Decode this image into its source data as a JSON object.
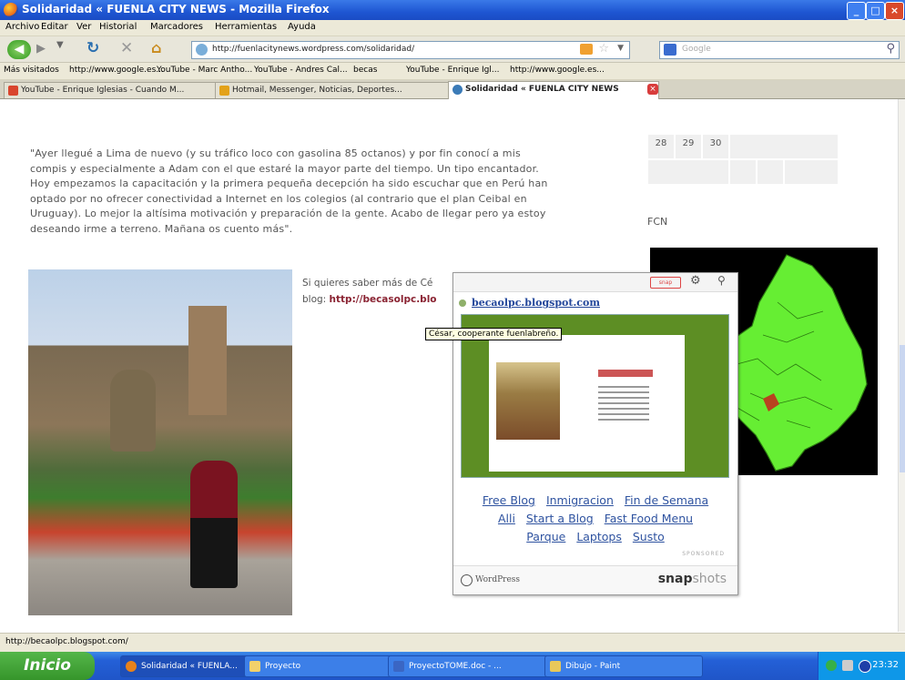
{
  "window": {
    "title": "Solidaridad « FUENLA CITY NEWS - Mozilla Firefox",
    "controls": {
      "minimize": "_",
      "maximize": "□",
      "close": "×"
    }
  },
  "menu": [
    "Archivo",
    "Editar",
    "Ver",
    "Historial",
    "Marcadores",
    "Herramientas",
    "Ayuda"
  ],
  "nav": {
    "url": "http://fuenlacitynews.wordpress.com/solidaridad/",
    "search_placeholder": "Google"
  },
  "bookmarks": [
    "Más visitados",
    "http://www.google.es...",
    "YouTube - Marc Antho...",
    "YouTube - Andres Cal...",
    "becas",
    "YouTube - Enrique Igl...",
    "http://www.google.es..."
  ],
  "tabs": [
    {
      "label": "YouTube - Enrique Iglesias - Cuando M...",
      "active": false,
      "color": "#d9452e"
    },
    {
      "label": "Hotmail, Messenger, Noticias, Deportes...",
      "active": false,
      "color": "#e3a21a"
    },
    {
      "label": "Solidaridad « FUENLA CITY NEWS",
      "active": true,
      "color": "#3b7bb7"
    }
  ],
  "article": {
    "paragraph": [
      "\"Ayer llegué a Lima de nuevo (y su tráfico loco con gasolina 85 octanos) y por fin conocí a mis",
      "compis y especialmente a Adam con el que estaré la mayor parte del tiempo. Un tipo encantador.",
      "Hoy empezamos la capacitación y la primera pequeña decepción ha sido escuchar que en Perú han",
      "optado por no ofrecer conectividad a Internet en los colegios (al contrario que el plan Ceibal en",
      "Uruguay). Lo mejor la altísima motivación y preparación de la gente. Acabo de llegar pero ya estoy",
      "deseando irme a terreno. Mañana os cuento más\"."
    ],
    "side_text_line1": "Si quieres saber más de Cé",
    "side_text_prefix": "blog: ",
    "side_link": "http://becasolpc.blo"
  },
  "sidebar": {
    "calendar_days": [
      "28",
      "29",
      "30"
    ],
    "widget_title": "FCN"
  },
  "snapshot": {
    "header_label": "snap",
    "url": "becaolpc.blogspot.com",
    "links": [
      [
        "Free Blog",
        "Inmigracion",
        "Fin de Semana"
      ],
      [
        "Alli",
        "Start a Blog",
        "Fast Food Menu"
      ],
      [
        "Parque",
        "Laptops",
        "Susto"
      ]
    ],
    "sponsored": "SPONSORED",
    "footer_left": "WordPress",
    "footer_brand": "snap",
    "footer_brand_suffix": "shots"
  },
  "tooltip": "César, cooperante fuenlabreño.",
  "status": "http://becaolpc.blogspot.com/",
  "taskbar": {
    "start": "Inicio",
    "items": [
      "Solidaridad « FUENLA...",
      "Proyecto",
      "ProyectoTOME.doc - ...",
      "Dibujo - Paint"
    ],
    "clock": "23:32"
  },
  "colors": {
    "link_red": "#8a2332",
    "snap_link_blue": "#2f53a0",
    "map_green": "#66ee33"
  }
}
